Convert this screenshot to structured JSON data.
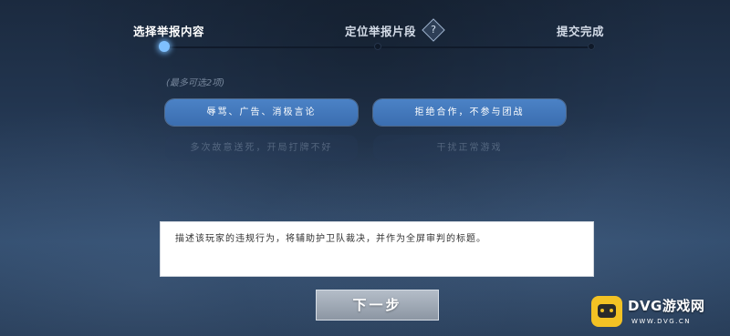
{
  "steps": [
    {
      "label": "选择举报内容",
      "active": true
    },
    {
      "label": "定位举报片段",
      "active": false
    },
    {
      "label": "提交完成",
      "active": false
    }
  ],
  "help_icon": {
    "glyph": "?",
    "icon": "question-diamond-icon"
  },
  "hint": "(最多可选2项)",
  "options": [
    {
      "label": "辱骂、广告、消极言论",
      "selected": true
    },
    {
      "label": "拒绝合作，不参与团战",
      "selected": true
    },
    {
      "label": "多次故意送死，开局打牌不好",
      "selected": false
    },
    {
      "label": "干扰正常游戏",
      "selected": false
    }
  ],
  "description": "描述该玩家的违规行为，将辅助护卫队裁决，并作为全屏审判的标题。",
  "next_button": "下一步",
  "watermark": {
    "title": "DVG游戏网",
    "subtitle": "WWW.DVG.CN"
  },
  "colors": {
    "accent": "#7fc0ff",
    "selected_option": "#4279bd",
    "background": "#24384f"
  }
}
